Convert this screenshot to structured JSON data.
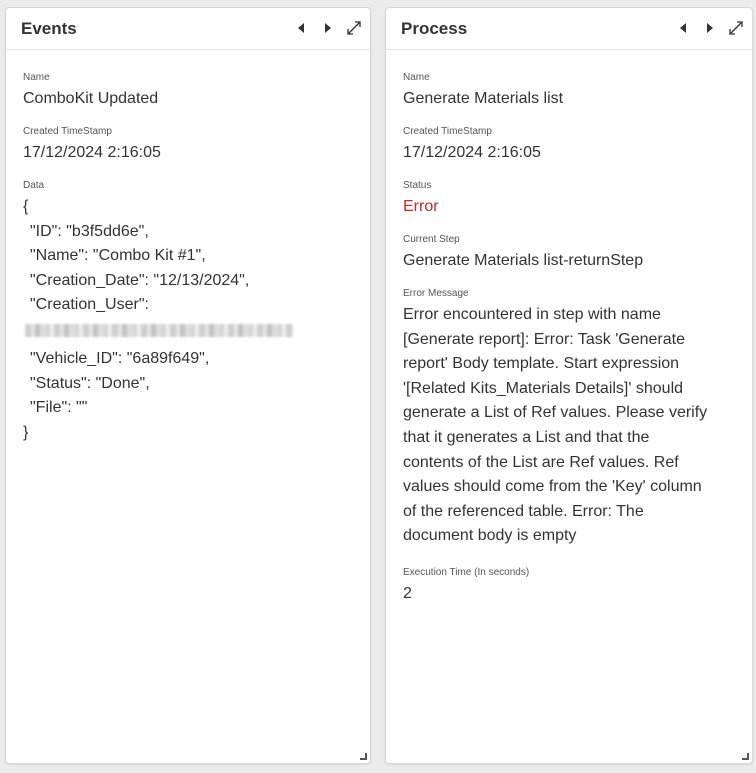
{
  "events_panel": {
    "title": "Events",
    "fields": {
      "name": {
        "label": "Name",
        "value": "ComboKit Updated"
      },
      "created": {
        "label": "Created TimeStamp",
        "value": "17/12/2024 2:16:05"
      },
      "data": {
        "label": "Data",
        "open_brace": "{",
        "lines": [
          "\"ID\": \"b3f5dd6e\",",
          "\"Name\": \"Combo Kit #1\",",
          "\"Creation_Date\": \"12/13/2024\",",
          "\"Creation_User\":",
          "\"Vehicle_ID\": \"6a89f649\",",
          "\"Status\": \"Done\",",
          "\"File\": \"\""
        ],
        "close_brace": "}"
      }
    }
  },
  "process_panel": {
    "title": "Process",
    "fields": {
      "name": {
        "label": "Name",
        "value": "Generate Materials list"
      },
      "created": {
        "label": "Created TimeStamp",
        "value": "17/12/2024 2:16:05"
      },
      "status": {
        "label": "Status",
        "value": "Error"
      },
      "current_step": {
        "label": "Current Step",
        "value": "Generate Materials list-returnStep"
      },
      "error_message": {
        "label": "Error Message",
        "lines": [
          "Error encountered in step with name",
          "[Generate report]: Error: Task 'Generate",
          "report' Body template. Start expression",
          "'[Related Kits_Materials Details]' should",
          "generate a List of Ref values. Please verify",
          "that it generates a List and that the",
          "contents of the List are Ref values. Ref",
          "values should come from the 'Key' column",
          "of the referenced table. Error: The",
          "document body is empty"
        ]
      },
      "execution_time": {
        "label": "Execution Time (In seconds)",
        "value": "2"
      }
    }
  },
  "icons": {
    "prev": "caret-left-icon",
    "next": "caret-right-icon",
    "expand": "expand-icon",
    "resize": "resize-grip-icon"
  },
  "colors": {
    "error": "#c62828",
    "panel_bg": "#ffffff",
    "page_bg": "#ececec"
  }
}
